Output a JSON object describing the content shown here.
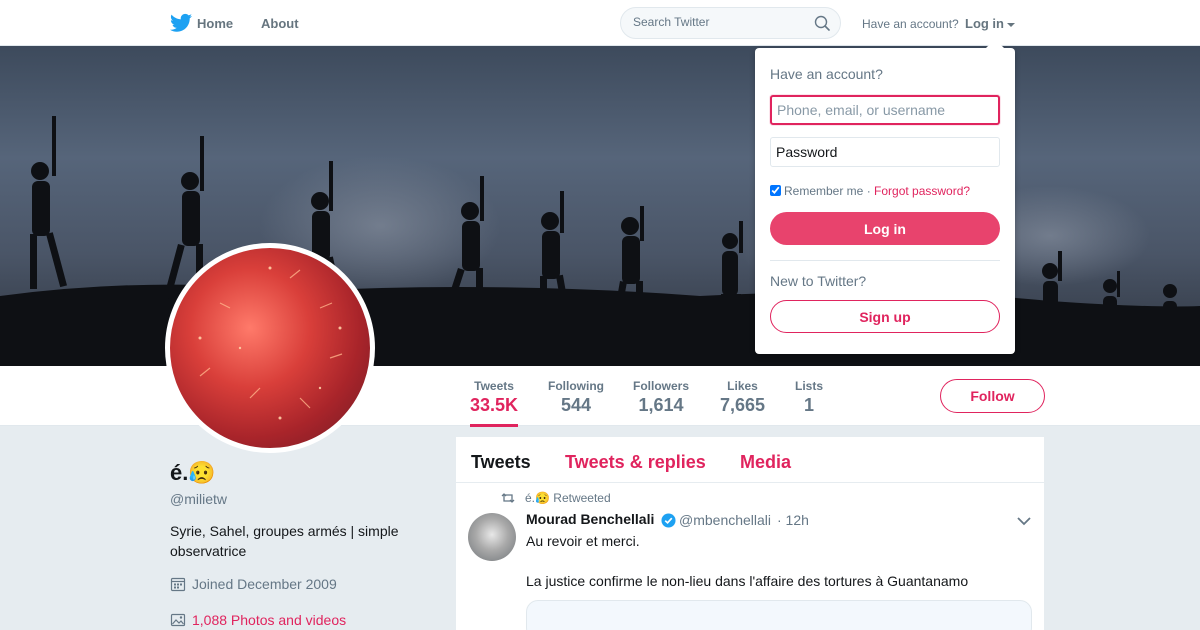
{
  "nav": {
    "home_label": "Home",
    "about_label": "About",
    "search_placeholder": "Search Twitter",
    "have_account": "Have an account?",
    "login_label": "Log in"
  },
  "profile": {
    "display_name": "é.😥",
    "screen_name": "@milietw",
    "bio": "Syrie, Sahel, groupes armés | simple observatrice",
    "joined": "Joined December 2009",
    "photos": "1,088 Photos and videos"
  },
  "stats": [
    {
      "label": "Tweets",
      "value": "33.5K",
      "active": true
    },
    {
      "label": "Following",
      "value": "544"
    },
    {
      "label": "Followers",
      "value": "1,614"
    },
    {
      "label": "Likes",
      "value": "7,665"
    },
    {
      "label": "Lists",
      "value": "1"
    }
  ],
  "follow_label": "Follow",
  "tabs": [
    "Tweets",
    "Tweets & replies",
    "Media"
  ],
  "tweet": {
    "retweet_text": "é.😥 Retweeted",
    "author_name": "Mourad Benchellali",
    "author_handle": "@mbenchellali",
    "time": "· 12h",
    "line1": "Au revoir et merci.",
    "line2": "La justice confirme le non-lieu dans l'affaire des tortures à Guantanamo"
  },
  "login_dropdown": {
    "title": "Have an account?",
    "username_placeholder": "Phone, email, or username",
    "password_placeholder": "Password",
    "remember": "Remember me",
    "separator": " · ",
    "forgot": "Forgot password?",
    "login_button": "Log in",
    "new_to_twitter": "New to Twitter?",
    "signup_button": "Sign up"
  },
  "colors": {
    "accent": "#e0245e",
    "twitter_blue": "#1da1f2",
    "background": "#e6ecf0"
  }
}
